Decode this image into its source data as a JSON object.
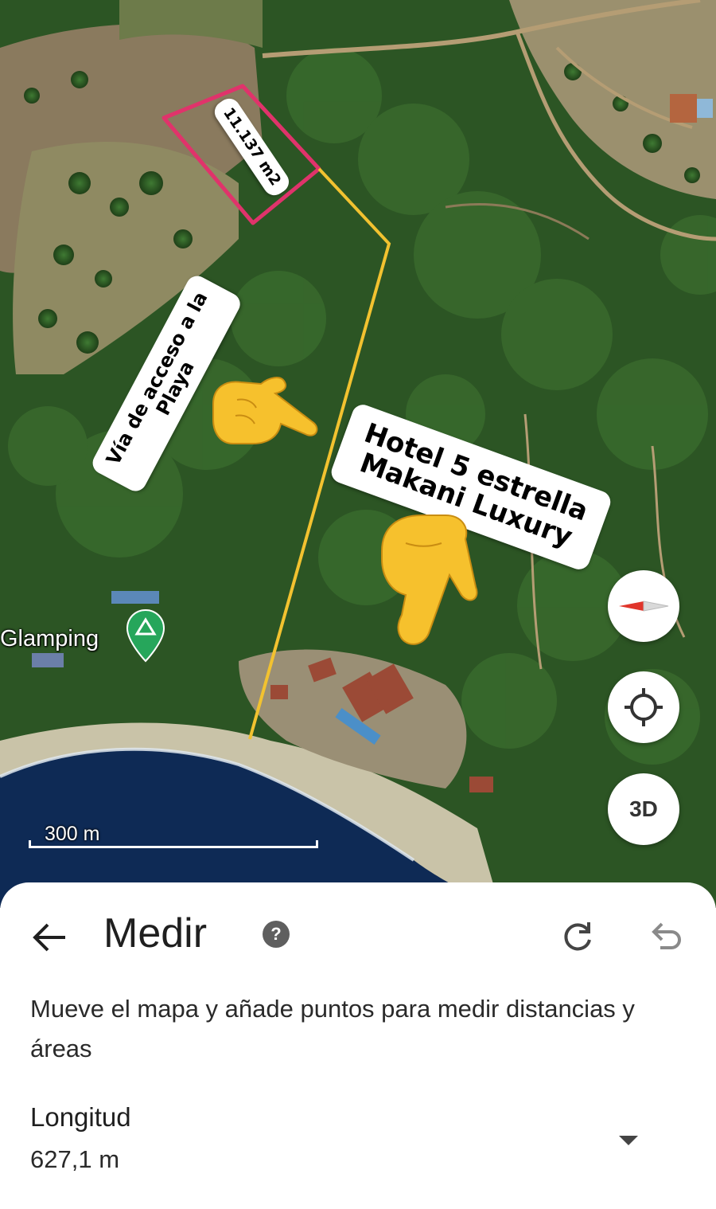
{
  "map": {
    "area_annotation": "11.137 m2",
    "access_annotation_line1": "Vía de acceso a la",
    "access_annotation_line2": "Playa",
    "hotel_annotation_line1": "Hotel 5 estrella",
    "hotel_annotation_line2": "Makani Luxury",
    "place_label": "Glamping",
    "scale_label": "300 m",
    "three_d_label": "3D",
    "icons": [
      "compass-icon",
      "my-location-icon",
      "campground-pin-icon",
      "pointing-hand-icon"
    ],
    "colors": {
      "parcel_outline": "#e0336b",
      "measure_line": "#f2c230",
      "pin": "#26a65b",
      "sea": "#0e2a55"
    }
  },
  "sheet": {
    "title": "Medir",
    "help_label": "?",
    "instructions": "Mueve el mapa y añade puntos para medir distancias y áreas",
    "measure_label": "Longitud",
    "measure_value": "627,1 m",
    "icons": [
      "back-arrow-icon",
      "help-icon",
      "redo-icon",
      "undo-icon",
      "dropdown-arrow-icon"
    ]
  }
}
